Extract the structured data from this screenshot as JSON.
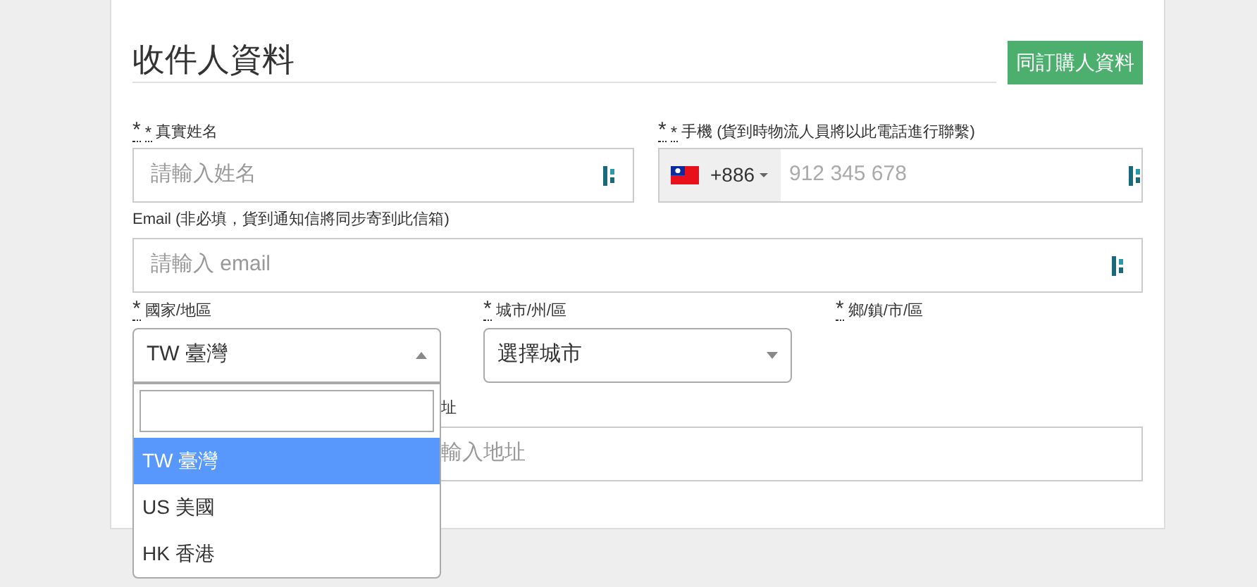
{
  "section": {
    "title": "收件人資料",
    "copy_button": "同訂購人資料"
  },
  "name_field": {
    "required_marks": [
      "*",
      "*"
    ],
    "label": "真實姓名",
    "placeholder": "請輸入姓名"
  },
  "phone_field": {
    "required_marks": [
      "*",
      "*"
    ],
    "label": "手機 (貨到時物流人員將以此電話進行聯繫)",
    "country_code": "+886",
    "placeholder": "912 345 678"
  },
  "email_field": {
    "label": "Email (非必填，貨到通知信將同步寄到此信箱)",
    "placeholder": "請輸入 email"
  },
  "location_fields": [
    {
      "kind": "select",
      "required_mark": "*",
      "label": "國家/地區",
      "value": "TW 臺灣",
      "expanded": true
    },
    {
      "kind": "select",
      "required_mark": "*",
      "label": "城市/州/區",
      "placeholder": "選擇城市",
      "expanded": false
    },
    {
      "kind": "label",
      "required_mark": "*",
      "label": "鄉/鎮/市/區"
    }
  ],
  "country_dropdown": {
    "options": [
      {
        "label": "TW 臺灣",
        "selected": true
      },
      {
        "label": "US 美國",
        "selected": false
      },
      {
        "label": "HK 香港",
        "selected": false
      }
    ]
  },
  "address_field": {
    "label": "址",
    "placeholder": "輸入地址"
  }
}
